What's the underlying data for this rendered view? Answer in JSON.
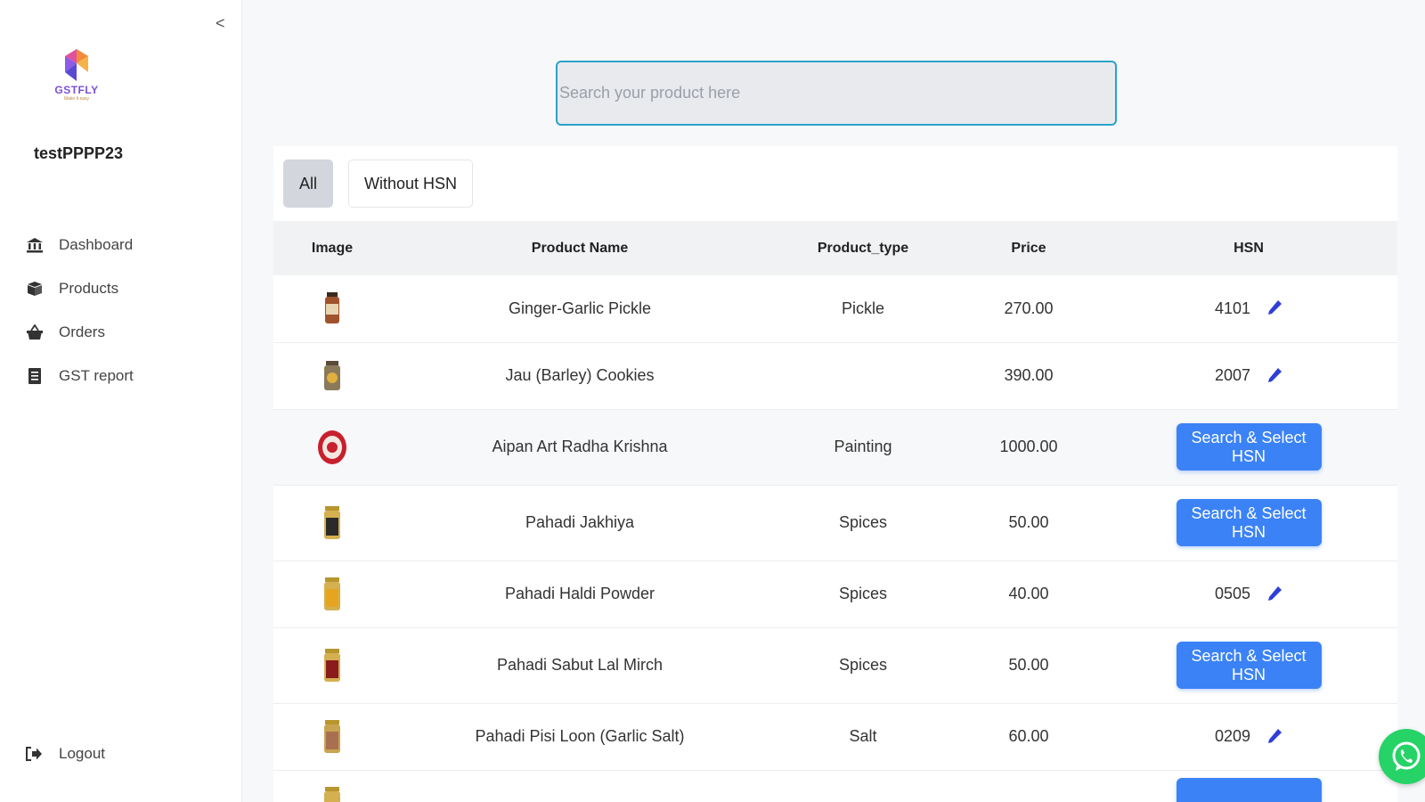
{
  "sidebar": {
    "collapse_glyph": "<",
    "logo_text": "GSTFLY",
    "logo_subtext": "Make it easy",
    "username": "testPPPP23",
    "nav": [
      {
        "label": "Dashboard",
        "icon": "bank-icon"
      },
      {
        "label": "Products",
        "icon": "products-box-icon"
      },
      {
        "label": "Orders",
        "icon": "basket-icon"
      },
      {
        "label": "GST report",
        "icon": "report-icon"
      }
    ],
    "logout_label": "Logout"
  },
  "search": {
    "placeholder": "Search your product here",
    "value": ""
  },
  "tabs": [
    {
      "label": "All",
      "active": true
    },
    {
      "label": "Without HSN",
      "active": false
    }
  ],
  "table": {
    "headers": [
      "Image",
      "Product Name",
      "Product_type",
      "Price",
      "HSN"
    ],
    "rows": [
      {
        "name": "Ginger-Garlic Pickle",
        "type": "Pickle",
        "price": "270.00",
        "hsn": "4101"
      },
      {
        "name": "Jau (Barley) Cookies",
        "type": "",
        "price": "390.00",
        "hsn": "2007"
      },
      {
        "name": "Aipan Art Radha Krishna",
        "type": "Painting",
        "price": "1000.00",
        "hsn": null
      },
      {
        "name": "Pahadi Jakhiya",
        "type": "Spices",
        "price": "50.00",
        "hsn": null
      },
      {
        "name": "Pahadi Haldi Powder",
        "type": "Spices",
        "price": "40.00",
        "hsn": "0505"
      },
      {
        "name": "Pahadi Sabut Lal Mirch",
        "type": "Spices",
        "price": "50.00",
        "hsn": null
      },
      {
        "name": "Pahadi Pisi Loon (Garlic Salt)",
        "type": "Salt",
        "price": "60.00",
        "hsn": "0209"
      }
    ],
    "select_hsn_label": "Search & Select HSN"
  },
  "colors": {
    "accent": "#3b82f6",
    "search_border": "#2aa3c9",
    "whatsapp": "#25d366",
    "edit_icon": "#2f3fd6"
  }
}
